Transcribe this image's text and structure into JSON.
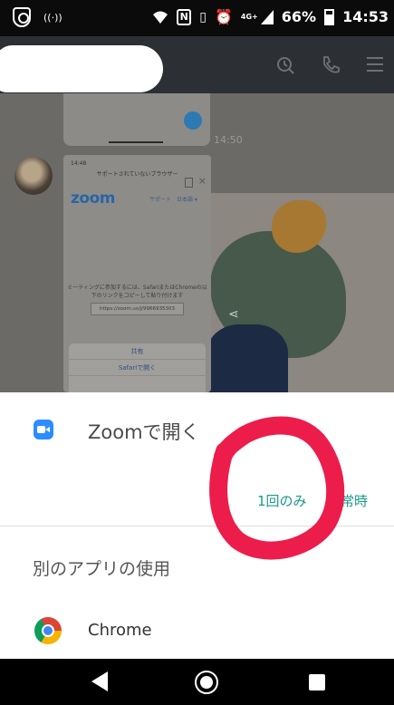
{
  "status_bar": {
    "battery": "66%",
    "time": "14:53",
    "network": "4G+",
    "icons": [
      "shield-icon",
      "radio-waves-icon",
      "wifi-icon",
      "nfc-icon",
      "vibrate-icon",
      "alarm-icon",
      "signal-icon",
      "battery-icon"
    ]
  },
  "header": {
    "icons": [
      "search-icon",
      "phone-icon",
      "menu-icon"
    ]
  },
  "chat": {
    "timestamp": "14:50",
    "screenshot": {
      "status_time": "14:48",
      "title": "サポートされていないブラウザー",
      "logo": "zoom",
      "nav": "サポート　日本語 ▾",
      "message": "ミーティングに参加するには、SafariまたはChromeの以下のリンクをコピーして貼り付けます",
      "url": "https://zoom.us/j/9966935303",
      "sheet_items": [
        "共有",
        "Safariで開く"
      ]
    }
  },
  "sheet": {
    "zoom_label": "Zoomで開く",
    "btn_once": "1回のみ",
    "btn_always": "常時",
    "other_apps_label": "別のアプリの使用",
    "chrome_label": "Chrome"
  },
  "colors": {
    "accent": "#1a9a8c",
    "annotation": "#ec1c4b",
    "zoom_blue": "#2d8cff"
  }
}
